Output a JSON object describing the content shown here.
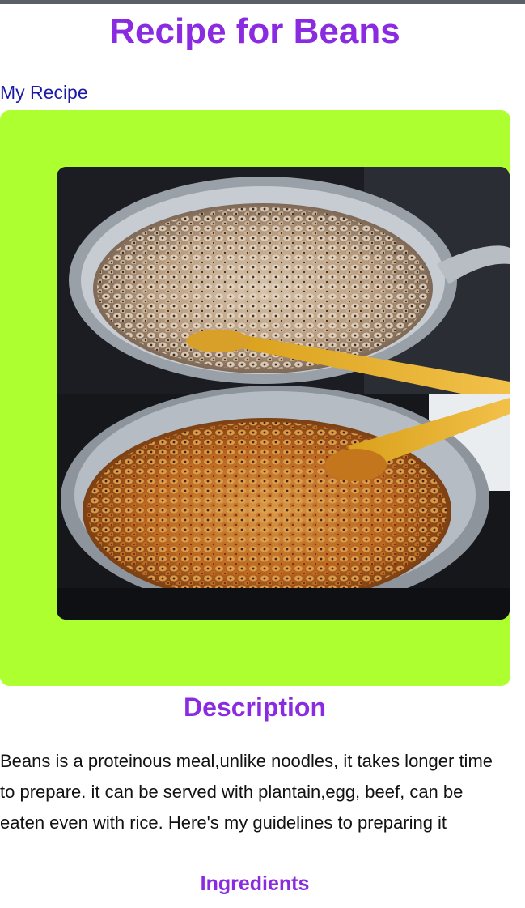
{
  "page": {
    "title": "Recipe for Beans",
    "nav_link": "My Recipe"
  },
  "hero_image": {
    "alt": "beans-in-pan-photo",
    "accent_color": "#adff2f"
  },
  "description": {
    "heading": "Description",
    "text": "Beans is a proteinous meal,unlike noodles, it takes longer time to prepare. it can be served with plantain,egg, beef, can be eaten even with rice. Here's my guidelines to preparing it"
  },
  "ingredients": {
    "heading": "Ingredients"
  },
  "colors": {
    "heading": "#8a2be2",
    "link": "#1a1aa6",
    "card": "#adff2f"
  }
}
